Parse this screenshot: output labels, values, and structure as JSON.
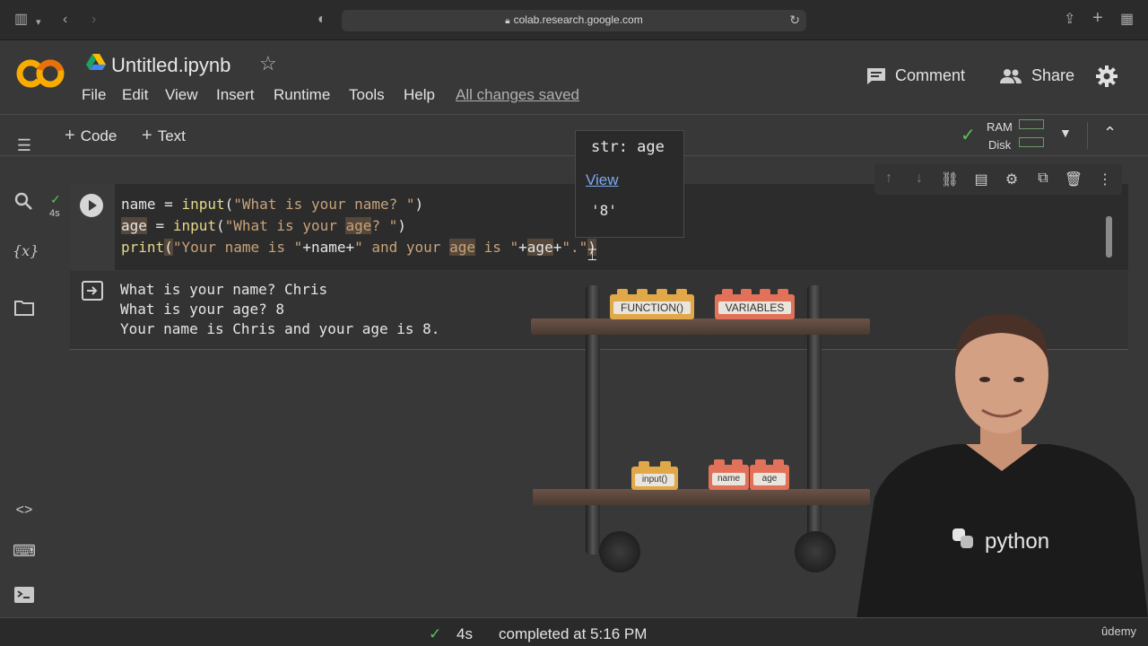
{
  "browser": {
    "url": "colab.research.google.com"
  },
  "header": {
    "logo": "CO",
    "notebook_title": "Untitled.ipynb",
    "menu": [
      "File",
      "Edit",
      "View",
      "Insert",
      "Runtime",
      "Tools",
      "Help"
    ],
    "save_status": "All changes saved",
    "comment_label": "Comment",
    "share_label": "Share"
  },
  "toolbar": {
    "add_code_label": "Code",
    "add_text_label": "Text",
    "ram_label": "RAM",
    "disk_label": "Disk"
  },
  "cell": {
    "run_time": "4s",
    "code_lines": [
      "name = input(\"What is your name? \")",
      "age = input(\"What is your age? \")",
      "print(\"Your name is \"+name+\" and your age is \"+age+\".\")"
    ]
  },
  "tooltip": {
    "type_text": "str: age",
    "view_link": "View",
    "value": "'8'"
  },
  "output": {
    "lines": [
      "What is your name? Chris",
      "What is your age? 8",
      "Your name is Chris and your age is 8."
    ]
  },
  "shelf": {
    "top_bricks": [
      "FUNCTION()",
      "VARIABLES"
    ],
    "bottom_bricks": [
      "input()",
      "name",
      "age"
    ]
  },
  "presenter": {
    "shirt_text": "python"
  },
  "statusbar": {
    "duration": "4s",
    "completed_text": "completed at 5:16 PM"
  },
  "watermark": "ûdemy",
  "colors": {
    "accent_orange": "#f9ab00",
    "success_green": "#5cc05c",
    "link_blue": "#7aaaf0"
  },
  "icons": [
    "sidebar-icon",
    "back-icon",
    "forward-icon",
    "shield-icon",
    "lock-icon",
    "reload-icon",
    "share-icon",
    "new-tab-icon",
    "tabs-grid-icon",
    "drive-icon",
    "star-icon",
    "comment-icon",
    "people-icon",
    "settings-icon",
    "toc-icon",
    "search-icon",
    "variables-icon",
    "folder-icon",
    "code-snippets-icon",
    "command-palette-icon",
    "terminal-icon"
  ]
}
